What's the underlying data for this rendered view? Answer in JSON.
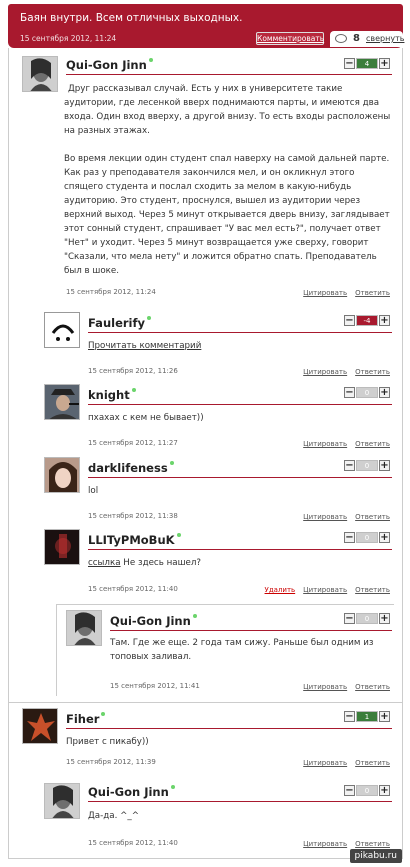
{
  "post": {
    "title": "Баян внутри. Всем отличных выходных.",
    "date": "15 сентября 2012, 11:24",
    "comment_button": "Комментировать",
    "comment_count": "8",
    "collapse_label": "свернуть"
  },
  "comments": [
    {
      "author": "Qui-Gon Jinn",
      "rating": "4",
      "rating_color": "#3a7d3a",
      "text_p1": "Друг рассказывал случай. Есть у них в университете такие аудитории, где лесенкой вверх поднимаются парты, и имеются два входа. Один вход вверху, а другой внизу. То есть входы расположены на разных этажах.",
      "text_p2": "Во время лекции один студент спал наверху на самой дальней парте. Как раз у преподавателя закончился мел, и он окликнул этого спящего студента и послал сходить за мелом в какую-нибудь аудиторию. Это студент, проснулся, вышел из аудитории через верхний выход. Через 5 минут открывается дверь внизу, заглядывает этот сонный студент, спрашивает \"У вас мел есть?\", получает ответ \"Нет\" и уходит. Через 5 минут возвращается уже сверху, говорит \"Сказали, что мела нету\" и ложится обратно спать. Преподаватель был в шоке.",
      "date": "15 сентября 2012, 11:24",
      "quote": "Цитировать",
      "reply": "Ответить"
    },
    {
      "author": "Faulerify",
      "rating": "-4",
      "rating_color": "#a8192e",
      "text": "Прочитать комментарий",
      "date": "15 сентября 2012, 11:26",
      "quote": "Цитировать",
      "reply": "Ответить"
    },
    {
      "author": "knight",
      "rating": "0",
      "rating_color": "#cfcfcf",
      "text": "пхахах с кем не бывает))",
      "date": "15 сентября 2012, 11:27",
      "quote": "Цитировать",
      "reply": "Ответить"
    },
    {
      "author": "darklifeness",
      "rating": "0",
      "rating_color": "#cfcfcf",
      "text": "lol",
      "date": "15 сентября 2012, 11:38",
      "quote": "Цитировать",
      "reply": "Ответить"
    },
    {
      "author": "LLITyPMoBuK",
      "rating": "0",
      "rating_color": "#cfcfcf",
      "text_link": "ссылка",
      "text_rest": " Не здесь нашел?",
      "date": "15 сентября 2012, 11:40",
      "delete": "Удалить",
      "quote": "Цитировать",
      "reply": "Ответить"
    },
    {
      "author": "Qui-Gon Jinn",
      "rating": "0",
      "rating_color": "#cfcfcf",
      "text": "Там. Где же еще. 2 года там сижу. Раньше был одним из топовых заливал.",
      "date": "15 сентября 2012, 11:41",
      "quote": "Цитировать",
      "reply": "Ответить"
    },
    {
      "author": "Fiher",
      "rating": "1",
      "rating_color": "#3a7d3a",
      "text": "Привет с пикабу))",
      "date": "15 сентября 2012, 11:39",
      "quote": "Цитировать",
      "reply": "Ответить"
    },
    {
      "author": "Qui-Gon Jinn",
      "rating": "0",
      "rating_color": "#cfcfcf",
      "text": "Да-да. ^_^",
      "date": "15 сентября 2012, 11:40",
      "quote": "Цитировать",
      "reply": "Ответить"
    }
  ],
  "watermark": "pikabu.ru"
}
